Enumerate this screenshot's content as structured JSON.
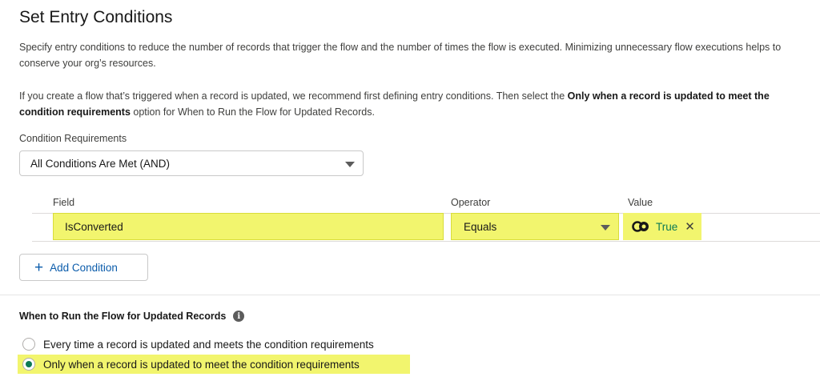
{
  "title": "Set Entry Conditions",
  "paragraph1": "Specify entry conditions to reduce the number of records that trigger the flow and the number of times the flow is executed. Minimizing unnecessary flow executions helps to conserve your org’s resources.",
  "paragraph2": {
    "part1": "If you create a flow that’s triggered when a record is updated, we recommend first defining entry conditions. Then select the ",
    "bold": "Only when a record is updated to meet the condition requirements",
    "part2": " option for When to Run the Flow for Updated Records."
  },
  "condition_requirements": {
    "label": "Condition Requirements",
    "selected": "All Conditions Are Met (AND)"
  },
  "columns": {
    "field": "Field",
    "operator": "Operator",
    "value": "Value"
  },
  "condition_row": {
    "field": "IsConverted",
    "operator": "Equals",
    "value": "True",
    "value_icon": "toggle-boolean-icon",
    "remove_icon": "close-icon"
  },
  "add_condition_label": "Add Condition",
  "when_to_run": {
    "label": "When to Run the Flow for Updated Records",
    "options": [
      {
        "label": "Every time a record is updated and meets the condition requirements",
        "selected": false
      },
      {
        "label": "Only when a record is updated to meet the condition requirements",
        "selected": true
      }
    ]
  },
  "colors": {
    "highlight": "#f2f56e",
    "link": "#0b5cab",
    "value_green": "#0b7a55"
  }
}
